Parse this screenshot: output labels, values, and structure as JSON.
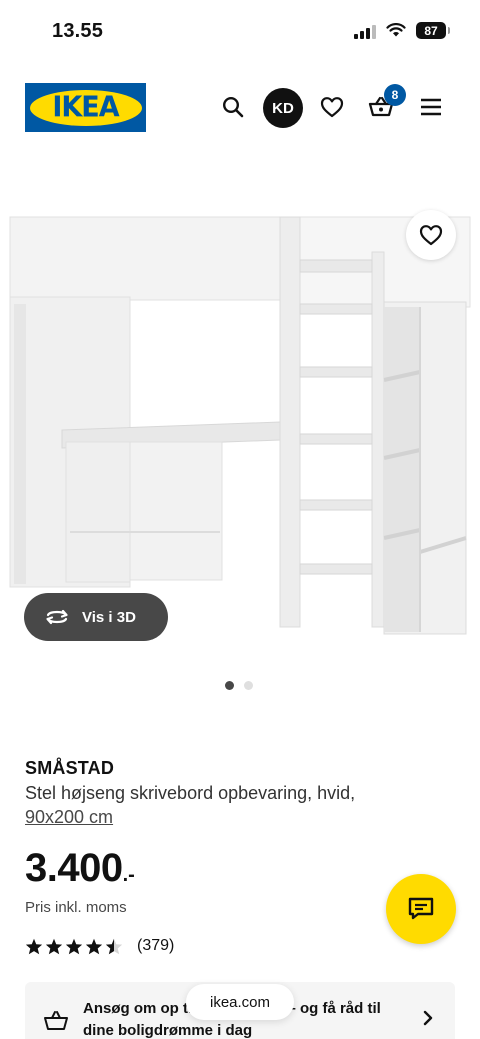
{
  "status_bar": {
    "time": "13.55",
    "battery": "87"
  },
  "header": {
    "logo_text": "IKEA",
    "avatar_initials": "KD",
    "cart_count": "8"
  },
  "product": {
    "view_3d_label": "Vis i 3D",
    "image_count": 2,
    "active_image": 1,
    "name": "SMÅSTAD",
    "description": "Stel højseng skrivebord opbevaring, hvid,",
    "size": "90x200 cm",
    "price": "3.400",
    "price_suffix": ".-",
    "price_note": "Pris inkl. moms",
    "rating_value": 4.5,
    "rating_count": "(379)"
  },
  "finance_banner": {
    "text": "Ansøg om op til IKEA Kredit – og få råd til dine boligdrømme i dag"
  },
  "browser": {
    "url": "ikea.com"
  },
  "colors": {
    "ikea_blue": "#0058a3",
    "ikea_yellow": "#ffdb00",
    "dark_gray": "#484848"
  }
}
